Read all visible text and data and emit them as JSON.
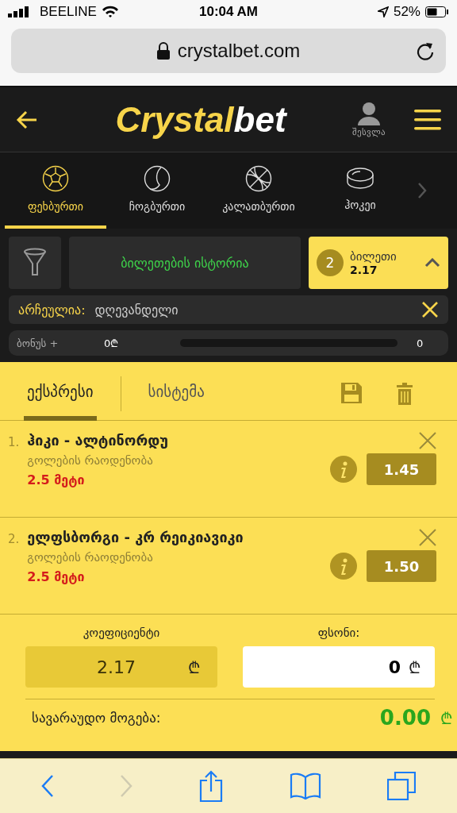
{
  "status_bar": {
    "carrier": "BEELINE",
    "time": "10:04 AM",
    "battery": "52%"
  },
  "address_bar": {
    "url": "crystalbet.com"
  },
  "header": {
    "logo_main": "Crystal",
    "logo_accent": "bet",
    "login_label": "შესვლა"
  },
  "sports": [
    {
      "kind": "football",
      "label": "ფეხბურთი",
      "selected": true
    },
    {
      "kind": "tennis",
      "label": "ჩოგბურთი",
      "selected": false
    },
    {
      "kind": "basketball",
      "label": "კალათბურთი",
      "selected": false
    },
    {
      "kind": "hockey",
      "label": "ჰოკეი",
      "selected": false
    }
  ],
  "ticket_history": {
    "label": "ბილეთების ისტორია"
  },
  "ticket": {
    "count": "2",
    "label": "ბილეთი",
    "odds": "2.17",
    "expanded": true
  },
  "filter": {
    "label": "არჩეულია:",
    "value": "დღევანდელი"
  },
  "bonus": {
    "label": "ბონუს +",
    "amount": "0₾",
    "value": "0"
  },
  "bet_tabs": [
    {
      "label": "ექსპრესი",
      "selected": true
    },
    {
      "label": "სისტემა",
      "selected": false
    }
  ],
  "bets": [
    {
      "number": "1.",
      "title": "ჰიკი - ალტინორდუ",
      "market": "გოლების რაოდენობა",
      "pick": "2.5 მეტი",
      "odds": "1.45"
    },
    {
      "number": "2.",
      "title": "ელფსბორგი - კრ რეიკიავიკი",
      "market": "გოლების რაოდენობა",
      "pick": "2.5 მეტი",
      "odds": "1.50"
    }
  ],
  "totals": {
    "odds_label": "კოეფიციენტი",
    "odds_value": "2.17",
    "odds_currency": "₾",
    "stake_label": "ფსონი:",
    "stake_value": "0",
    "stake_currency": "₾",
    "win_label": "სავარაუდო მოგება:",
    "win_value": "0.00",
    "win_currency": "₾"
  },
  "toolbar": [
    {
      "kind": "back",
      "disabled": false
    },
    {
      "kind": "forward",
      "disabled": true
    },
    {
      "kind": "share",
      "disabled": false
    },
    {
      "kind": "bookmarks",
      "disabled": false
    },
    {
      "kind": "tabs",
      "disabled": false
    }
  ]
}
